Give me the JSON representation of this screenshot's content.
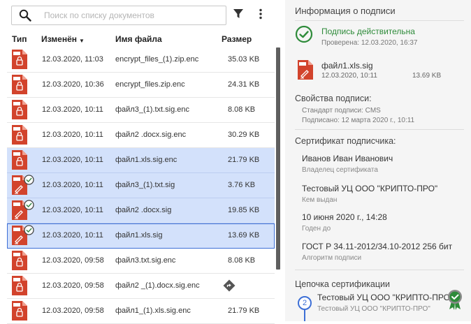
{
  "search": {
    "placeholder": "Поиск по списку документов"
  },
  "table": {
    "headers": {
      "type": "Тип",
      "modified": "Изменён",
      "filename": "Имя файла",
      "size": "Размер"
    },
    "rows": [
      {
        "icon": "enc",
        "date": "12.03.2020, 11:03",
        "name": "encrypt_files_(1).zip.enc",
        "size": "35.03 KB",
        "selected": false
      },
      {
        "icon": "enc",
        "date": "12.03.2020, 10:36",
        "name": "encrypt_files.zip.enc",
        "size": "24.31 KB",
        "selected": false
      },
      {
        "icon": "enc",
        "date": "12.03.2020, 10:11",
        "name": "файл3_(1).txt.sig.enc",
        "size": "8.08 KB",
        "selected": false
      },
      {
        "icon": "enc",
        "date": "12.03.2020, 10:11",
        "name": "файл2 .docx.sig.enc",
        "size": "30.29 KB",
        "selected": false
      },
      {
        "icon": "enc",
        "date": "12.03.2020, 10:11",
        "name": "файл1.xls.sig.enc",
        "size": "21.79 KB",
        "selected": true
      },
      {
        "icon": "sig",
        "date": "12.03.2020, 10:11",
        "name": "файл3_(1).txt.sig",
        "size": "3.76 KB",
        "selected": true
      },
      {
        "icon": "sig",
        "date": "12.03.2020, 10:11",
        "name": "файл2 .docx.sig",
        "size": "19.85 KB",
        "selected": true
      },
      {
        "icon": "sig",
        "date": "12.03.2020, 10:11",
        "name": "файл1.xls.sig",
        "size": "13.69 KB",
        "selected": true,
        "outline": true
      },
      {
        "icon": "enc",
        "date": "12.03.2020, 09:58",
        "name": "файл3.txt.sig.enc",
        "size": "8.08 KB",
        "selected": false
      },
      {
        "icon": "enc",
        "date": "12.03.2020, 09:58",
        "name": "файл2 _(1).docx.sig.enc",
        "size": "",
        "action_icon": "directions-diamond-icon",
        "selected": false
      },
      {
        "icon": "enc",
        "date": "12.03.2020, 09:58",
        "name": "файл1_(1).xls.sig.enc",
        "size": "21.79 KB",
        "selected": false
      }
    ]
  },
  "panel": {
    "title": "Информация о подписи",
    "status": "Подпись действительна",
    "checked": "Проверена: 12.03.2020, 16:37",
    "file": {
      "name": "файл1.xls.sig",
      "date": "12.03.2020, 10:11",
      "size": "13.69 KB"
    },
    "props_title": "Свойства подписи:",
    "standard": "Стандарт подписи: CMS",
    "signed": "Подписано: 12 марта 2020 г., 10:11",
    "cert_title": "Сертификат подписчика:",
    "owner": "Иванов Иван Иванович",
    "owner_label": "Владелец сертификата",
    "issuer": "Тестовый УЦ ООО \"КРИПТО-ПРО\"",
    "issuer_label": "Кем выдан",
    "valid_to": "10 июня 2020 г., 14:28",
    "valid_to_label": "Годен до",
    "algorithm": "ГОСТ Р 34.11-2012/34.10-2012 256 бит",
    "algorithm_label": "Алгоритм подписи",
    "chain_title": "Цепочка сертификации",
    "chain": [
      {
        "num": "2",
        "name": "Тестовый УЦ ООО \"КРИПТО-ПРО\"",
        "sub": "Тестовый УЦ ООО \"КРИПТО-ПРО\""
      }
    ]
  },
  "colors": {
    "file_icon": "#d2432c",
    "accent": "#3d6fd6",
    "valid": "#2e8b3a",
    "selection": "#d3e1fb"
  }
}
